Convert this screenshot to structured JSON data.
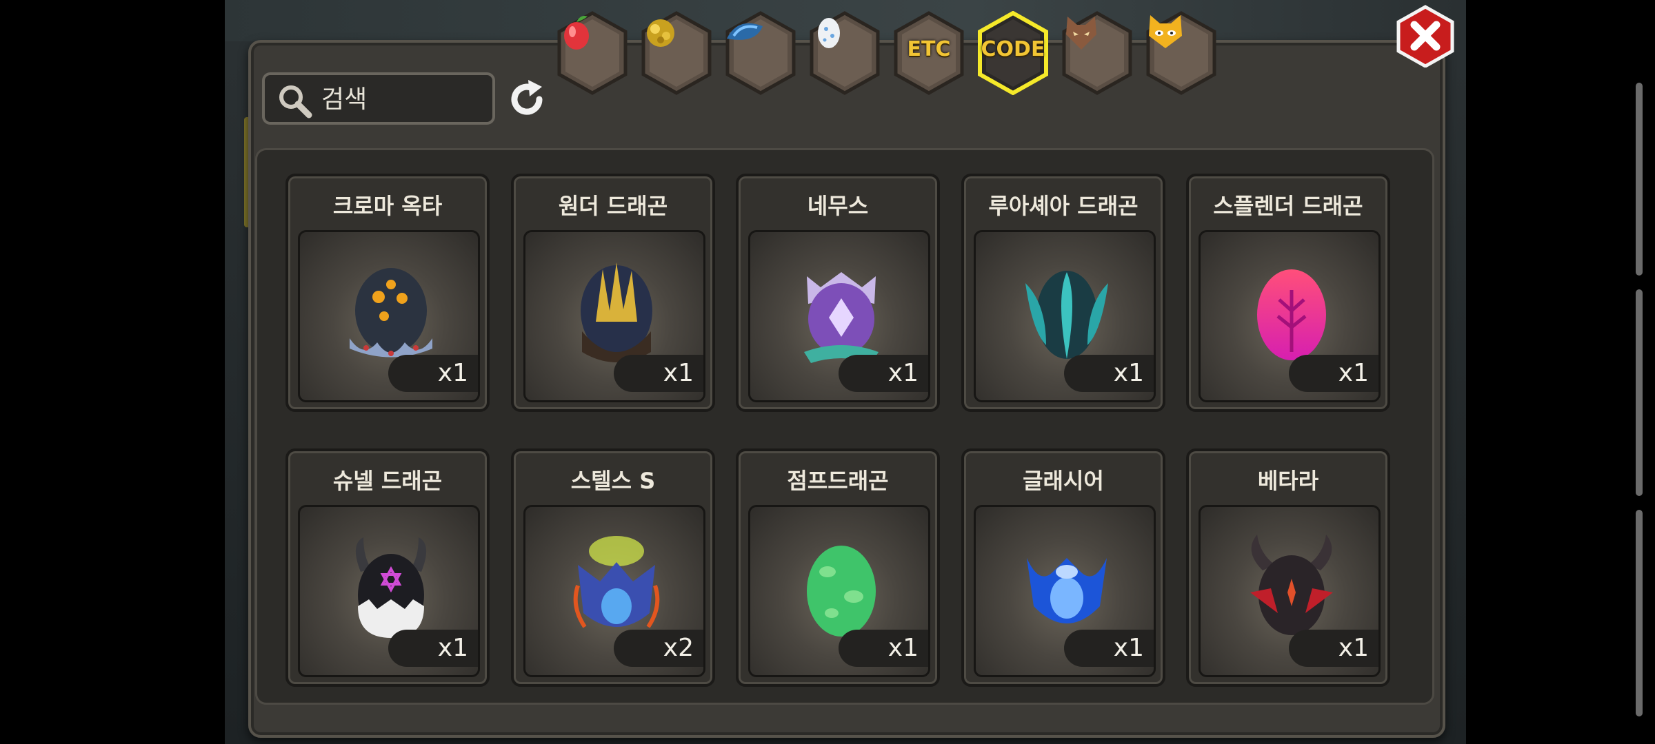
{
  "search": {
    "placeholder": "검색"
  },
  "tabs": [
    {
      "id": "fruit",
      "icon": "fruit-icon",
      "label": ""
    },
    {
      "id": "gold",
      "icon": "gold-ore-icon",
      "label": ""
    },
    {
      "id": "scale",
      "icon": "dragon-scale-icon",
      "label": ""
    },
    {
      "id": "egg",
      "icon": "egg-icon",
      "label": ""
    },
    {
      "id": "etc",
      "icon": "",
      "label": "ETC"
    },
    {
      "id": "code",
      "icon": "",
      "label": "CODE",
      "selected": true
    },
    {
      "id": "wolf",
      "icon": "wolf-head-icon",
      "label": ""
    },
    {
      "id": "cat",
      "icon": "cat-face-icon",
      "label": ""
    }
  ],
  "items": [
    {
      "name": "크로마 옥타",
      "qty": "x1",
      "icon": "chroma-octa-egg-icon",
      "color": "#2b3340"
    },
    {
      "name": "원더 드래곤",
      "qty": "x1",
      "icon": "wonder-dragon-egg-icon",
      "color": "#2a2f45"
    },
    {
      "name": "네무스",
      "qty": "x1",
      "icon": "nemus-egg-icon",
      "color": "#8a5fc4"
    },
    {
      "name": "루아셰아 드래곤",
      "qty": "x1",
      "icon": "luasea-dragon-egg-icon",
      "color": "#1f6e72"
    },
    {
      "name": "스플렌더 드래곤",
      "qty": "x1",
      "icon": "splendor-dragon-egg-icon",
      "color": "#e0308e"
    },
    {
      "name": "슈넬 드래곤",
      "qty": "x1",
      "icon": "schnell-dragon-egg-icon",
      "color": "#1a1a1e"
    },
    {
      "name": "스텔스 S",
      "qty": "x2",
      "icon": "stealth-s-egg-icon",
      "color": "#3a4fb0"
    },
    {
      "name": "점프드래곤",
      "qty": "x1",
      "icon": "jump-dragon-egg-icon",
      "color": "#3fc46a"
    },
    {
      "name": "글래시어",
      "qty": "x1",
      "icon": "glacier-egg-icon",
      "color": "#1c55d8"
    },
    {
      "name": "베타라",
      "qty": "x1",
      "icon": "betara-egg-icon",
      "color": "#2a2428"
    }
  ]
}
